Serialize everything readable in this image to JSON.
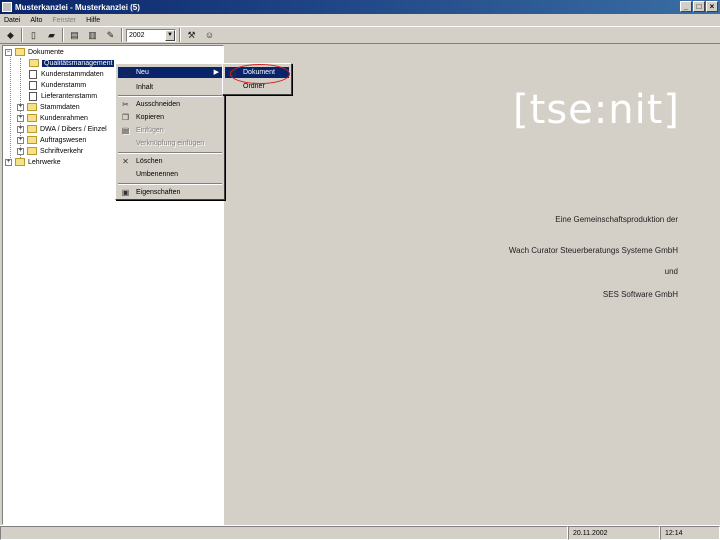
{
  "window": {
    "title": "Musterkanzlei - Musterkanzlei (5)",
    "minimize": "_",
    "maximize": "□",
    "close": "×"
  },
  "menubar": {
    "items": [
      "Datei",
      "Alto",
      "Fenster",
      "Hilfe"
    ]
  },
  "toolbar": {
    "year": "2002",
    "year_arrow": "▼"
  },
  "tree": {
    "root": "Dokumente",
    "items": [
      {
        "label": "Qualitätsmanagement",
        "selected": true
      },
      {
        "label": "Kundenstammdaten"
      },
      {
        "label": "Kundenstamm"
      },
      {
        "label": "Lieferantenstamm"
      },
      {
        "label": "Stammdaten"
      },
      {
        "label": "Kundenrahmen"
      },
      {
        "label": "DWA / Dibers / Einzel"
      },
      {
        "label": "Auftragswesen"
      },
      {
        "label": "Schriftverkehr"
      }
    ],
    "second_root": "Lehrwerke"
  },
  "context_menu": {
    "items": [
      {
        "label": "Neu",
        "icon": "new-icon",
        "glyph": "▢",
        "submenu": true,
        "highlighted": true
      },
      {
        "label": "Inhalt",
        "icon": "",
        "glyph": ""
      },
      {
        "label": "Ausschneiden",
        "icon": "cut-icon",
        "glyph": "✂"
      },
      {
        "label": "Kopieren",
        "icon": "copy-icon",
        "glyph": "❐"
      },
      {
        "label": "Einfügen",
        "icon": "paste-icon",
        "glyph": "▤",
        "disabled": true
      },
      {
        "label": "Verknüpfung einfügen",
        "icon": "",
        "glyph": "",
        "disabled": true
      },
      {
        "label": "Löschen",
        "icon": "delete-icon",
        "glyph": "✕"
      },
      {
        "label": "Umbenennen",
        "icon": "",
        "glyph": ""
      },
      {
        "label": "Eigenschaften",
        "icon": "properties-icon",
        "glyph": "▣"
      }
    ],
    "submenu_arrow": "▶"
  },
  "submenu": {
    "items": [
      {
        "label": "Dokument",
        "icon": "document-icon",
        "glyph": "▤",
        "highlighted": true
      },
      {
        "label": "Ordner",
        "icon": "",
        "glyph": ""
      }
    ]
  },
  "content": {
    "brand": "[tse:nit]",
    "line1": "Eine Gemeinschaftsproduktion der",
    "line2": "Wach Curator Steuerberatungs Systeme GmbH",
    "line3": "und",
    "line4": "SES Software GmbH"
  },
  "status": {
    "date": "20.11.2002",
    "time": "12:14"
  },
  "colors": {
    "titlebar": "#0a246a",
    "highlight": "#0a246a",
    "annotation_circle": "#d52020"
  }
}
